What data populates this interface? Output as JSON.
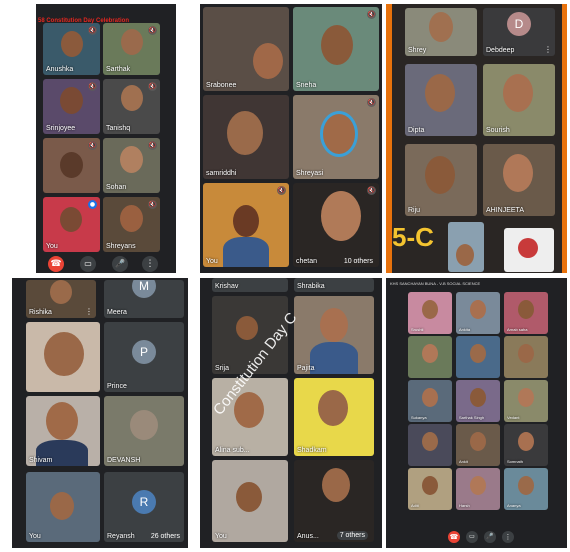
{
  "colors": {
    "page_bg": "#ffffff",
    "call_bg": "#202124",
    "end_call": "#ea4335",
    "orange": "#e8720c",
    "accent_overlay": "#f4f4f4"
  },
  "panel1": {
    "banner": "58 Constitution Day Celebration",
    "tiles": [
      {
        "name": "Anushka"
      },
      {
        "name": "Sarthak"
      },
      {
        "name": "Srinjoyee"
      },
      {
        "name": "Tanishq"
      },
      {
        "name": ""
      },
      {
        "name": "Sohan"
      },
      {
        "name": "You"
      },
      {
        "name": "Shreyans"
      }
    ],
    "controls": [
      "end-call",
      "camera",
      "microphone",
      "more"
    ]
  },
  "panel2": {
    "tiles": [
      {
        "name": "Srabonee"
      },
      {
        "name": "Sneha"
      },
      {
        "name": "samriddhi"
      },
      {
        "name": "Shreyasi"
      },
      {
        "name": "You"
      },
      {
        "name": "chetan"
      }
    ],
    "others_label": "10 others"
  },
  "panel3": {
    "avatar_letter": "D",
    "tiles": [
      {
        "name": "Shrey"
      },
      {
        "name": "Debdeep"
      },
      {
        "name": "Dipta"
      },
      {
        "name": "Sourish"
      },
      {
        "name": "Riju"
      },
      {
        "name": "AHINJEETA"
      }
    ],
    "class_label": "5-C"
  },
  "panel4": {
    "tiles": [
      {
        "name": "Rishika"
      },
      {
        "name": "Meera"
      },
      {
        "name": ""
      },
      {
        "name": "Prince"
      },
      {
        "name": "Shivam"
      },
      {
        "name": "DEVANSH"
      },
      {
        "name": "You"
      },
      {
        "name": "Reyansh"
      }
    ],
    "avatars": {
      "meera": "M",
      "prince": "P",
      "reyansh": "R"
    },
    "others_label": "26 others"
  },
  "panel5": {
    "tiles": [
      {
        "name": "Krishav"
      },
      {
        "name": "Shrabika"
      },
      {
        "name": "Srija"
      },
      {
        "name": "Pajita"
      },
      {
        "name": "Alina sub..."
      },
      {
        "name": "Shadkam"
      },
      {
        "name": "You"
      },
      {
        "name": "Anus..."
      }
    ],
    "watermark": "Constitution Day C",
    "others_label": "7 others"
  },
  "panel6": {
    "header": "KHS SANCHAYAN BUNA - V-B SOCIAL SCIENCE",
    "tile_names": [
      "Srushti",
      "Ankita",
      "Arnab saha",
      "",
      "",
      "",
      "Sukanya",
      "Sarthak Singh",
      "Vedant",
      "",
      "Ankit",
      "Somnath",
      "Aditi",
      "Harsh",
      "Ananya"
    ],
    "controls": [
      "end-call",
      "camera",
      "microphone",
      "more"
    ]
  }
}
